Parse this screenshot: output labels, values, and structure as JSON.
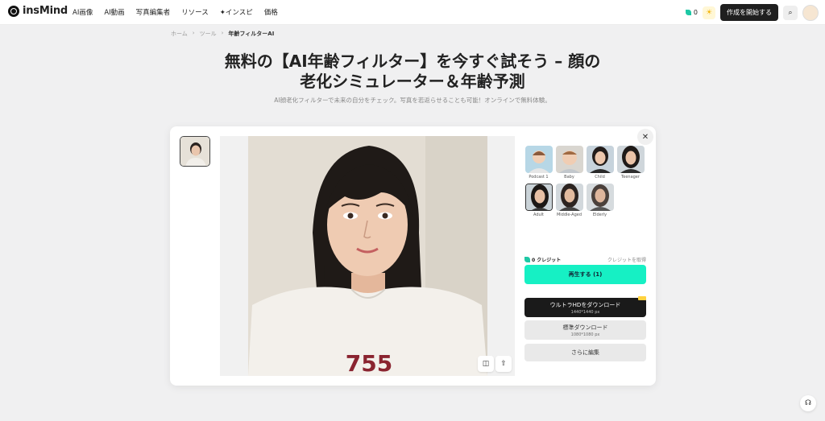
{
  "brand": {
    "name": "insMind"
  },
  "nav": {
    "links": [
      "AI画像",
      "AI動画",
      "写真編集者",
      "リソース",
      "インスピ",
      "価格"
    ],
    "credits": "0",
    "create_label": "作成を開始する"
  },
  "breadcrumb": [
    "ホーム",
    "ツール",
    "年齢フィルターAI"
  ],
  "hero": {
    "title_line1": "無料の【AI年齢フィルター】を今すぐ試そう – 顔の",
    "title_line2": "老化シミュレーター＆年齢予測",
    "subtitle": "AI顔老化フィルターで未来の自分をチェック。写真を若返らせることも可能！オンラインで無料体験。"
  },
  "ages": [
    {
      "label": "Podcast 1",
      "selected": false
    },
    {
      "label": "Baby",
      "selected": false
    },
    {
      "label": "Child",
      "selected": false
    },
    {
      "label": "Teenager",
      "selected": false
    },
    {
      "label": "Adult",
      "selected": true
    },
    {
      "label": "Middle-Aged",
      "selected": false
    },
    {
      "label": "Elderly",
      "selected": false
    }
  ],
  "panel": {
    "credit_label": "0 クレジット",
    "credit_link": "クレジットを取得",
    "generate_label": "再生する (1)",
    "hd_label": "ウルトラHDをダウンロード",
    "hd_size": "1440*1440 px",
    "std_label": "標準ダウンロード",
    "std_size": "1080*1080 px",
    "more_label": "さらに編集"
  },
  "photo": {
    "shirt_text": "755"
  },
  "colors": {
    "accent": "#16f0c4",
    "dark": "#1a1a1a",
    "background": "#f0f0f1"
  }
}
